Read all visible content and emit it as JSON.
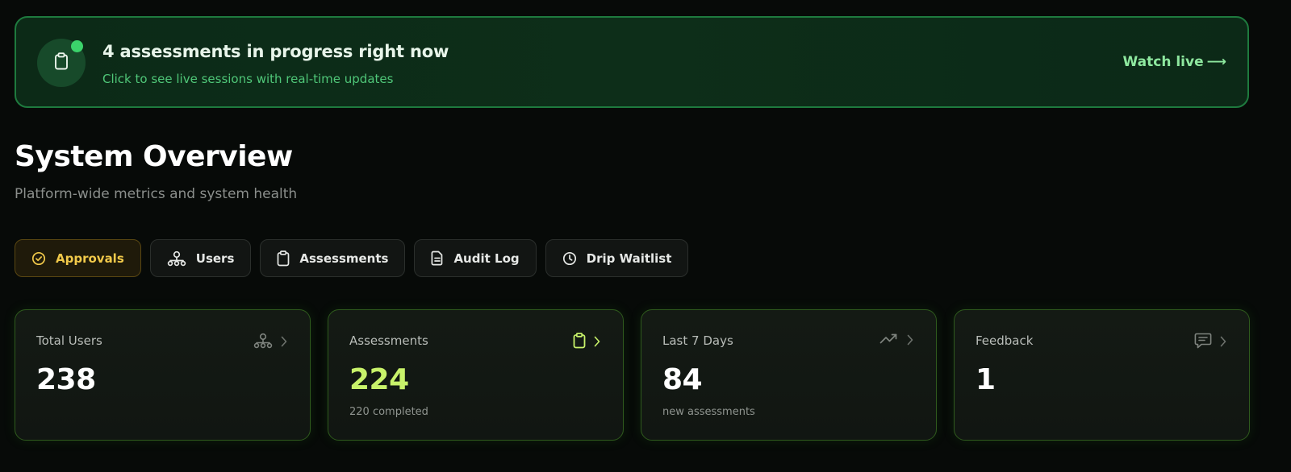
{
  "banner": {
    "title": "4 assessments in progress right now",
    "subtitle": "Click to see live sessions with real-time updates",
    "cta_label": "Watch live",
    "cta_arrow": "⟶",
    "icon": "clipboard-icon",
    "status_dot_color": "#3bd36b"
  },
  "header": {
    "title": "System Overview",
    "subtitle": "Platform-wide metrics and system health"
  },
  "tabs": [
    {
      "label": "Approvals",
      "icon": "check-circle-icon",
      "active": true
    },
    {
      "label": "Users",
      "icon": "users-icon",
      "active": false
    },
    {
      "label": "Assessments",
      "icon": "clipboard-icon",
      "active": false
    },
    {
      "label": "Audit Log",
      "icon": "document-icon",
      "active": false
    },
    {
      "label": "Drip Waitlist",
      "icon": "clock-icon",
      "active": false
    }
  ],
  "stats": [
    {
      "label": "Total Users",
      "value": "238",
      "note": "",
      "icon": "users-icon"
    },
    {
      "label": "Assessments",
      "value": "224",
      "note": "220 completed",
      "icon": "clipboard-icon"
    },
    {
      "label": "Last 7 Days",
      "value": "84",
      "note": "new assessments",
      "icon": "trending-up-icon"
    },
    {
      "label": "Feedback",
      "value": "1",
      "note": "",
      "icon": "message-icon"
    }
  ],
  "colors": {
    "accent_green": "#3bd36b",
    "accent_lime": "#c8f26a",
    "accent_amber": "#f1c94a",
    "background": "#070a08"
  }
}
